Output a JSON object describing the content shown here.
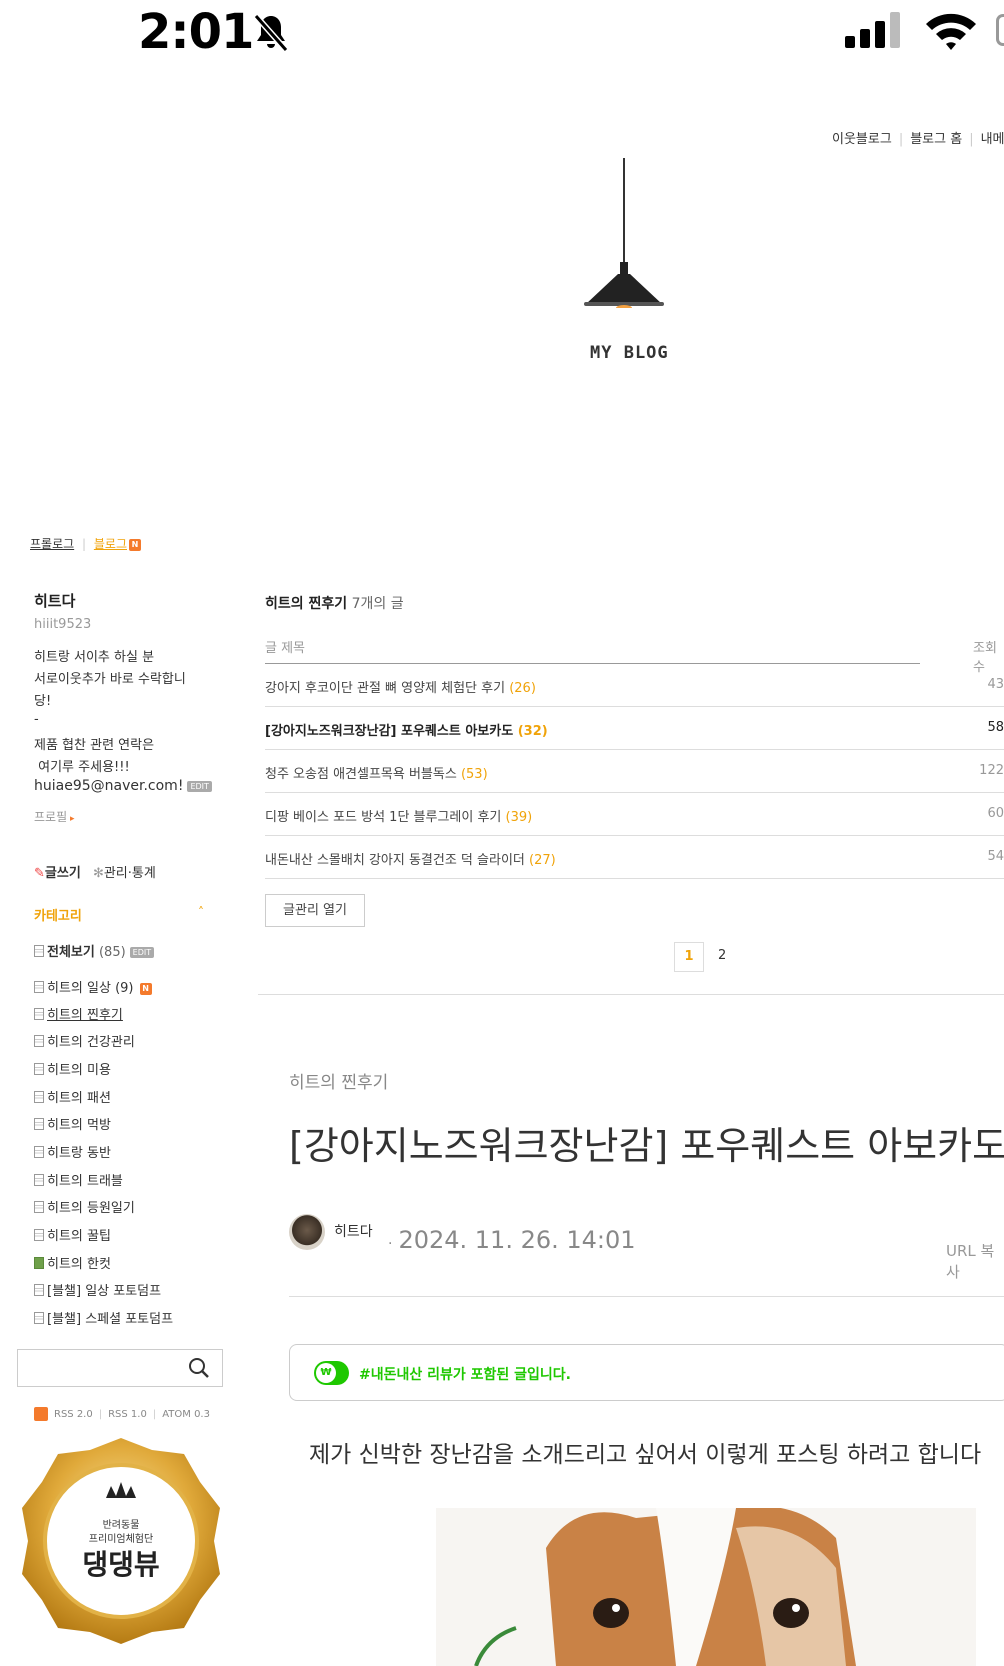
{
  "status_bar": {
    "time": "2:01"
  },
  "top_links": [
    "이웃블로그",
    "블로그 홈",
    "내메"
  ],
  "blog": {
    "title": "MY BLOG"
  },
  "tabs": {
    "prologue": "프롤로그",
    "blog": "블로그",
    "new_badge": "N"
  },
  "profile": {
    "name": "히트다",
    "id": "hiiit9523",
    "lines": [
      "히트랑 서이추 하실 분",
      "서로이웃추가 바로 수락합니",
      "당!",
      "-",
      "제품 협찬 관련 연락은",
      " 여기루 주세용!!!",
      "huiae95@naver.com!"
    ],
    "edit_badge": "EDIT",
    "profile_link": "프로필"
  },
  "sidebar": {
    "write": "글쓰기",
    "manage": "관리·통계",
    "category_title": "카테고리",
    "categories": [
      {
        "label": "전체보기",
        "count": "(85)"
      },
      {
        "label": "히트의 일상",
        "count": "(9)"
      },
      {
        "label": "히트의 찐후기",
        "count": ""
      },
      {
        "label": "히트의 건강관리",
        "count": ""
      },
      {
        "label": "히트의 미용",
        "count": ""
      },
      {
        "label": "히트의 패션",
        "count": ""
      },
      {
        "label": "히트의 먹방",
        "count": ""
      },
      {
        "label": "히트랑 동반",
        "count": ""
      },
      {
        "label": "히트의 트래블",
        "count": ""
      },
      {
        "label": "히트의 등원일기",
        "count": ""
      },
      {
        "label": "히트의 꿀팁",
        "count": ""
      },
      {
        "label": "히트의 한컷",
        "count": ""
      },
      {
        "label": "[블챌] 일상 포토덤프",
        "count": ""
      },
      {
        "label": "[블챌] 스페셜 포토덤프",
        "count": ""
      }
    ],
    "rss": [
      "RSS 2.0",
      "RSS 1.0",
      "ATOM 0.3"
    ],
    "medal": {
      "top": "반려동물",
      "middle": "프리미엄체험단",
      "main": "댕댕뷰"
    }
  },
  "post_list": {
    "category": "히트의 찐후기",
    "count_text": "7개의 글",
    "col_title": "글 제목",
    "col_views": "조회수",
    "rows": [
      {
        "title": "강아지 후코이단 관절 뼈 영양제 체험단 후기",
        "comments": "(26)",
        "views": "43"
      },
      {
        "title": "[강아지노즈워크장난감] 포우퀘스트 아보카도",
        "comments": "(32)",
        "views": "58"
      },
      {
        "title": "청주 오송점 애견셀프목욕 버블독스",
        "comments": "(53)",
        "views": "122"
      },
      {
        "title": "디팡 베이스 포드 방석 1단 블루그레이 후기",
        "comments": "(39)",
        "views": "60"
      },
      {
        "title": "내돈내산 스몰배치 강아지 동결건조 덕 슬라이더",
        "comments": "(27)",
        "views": "54"
      }
    ],
    "manage_button": "글관리 열기",
    "pages": [
      "1",
      "2"
    ]
  },
  "post": {
    "category": "히트의 찐후기",
    "title": "[강아지노즈워크장난감] 포우퀘스트 아보카도",
    "author": "히트다",
    "date": "2024. 11. 26. 14:01",
    "url_copy": "URL 복사",
    "notice": "#내돈내산 리뷰가 포함된 글입니다.",
    "notice_toggle": "₩",
    "body": "제가 신박한 장난감을 소개드리고 싶어서 이렇게 포스팅 하려고 합니다"
  }
}
